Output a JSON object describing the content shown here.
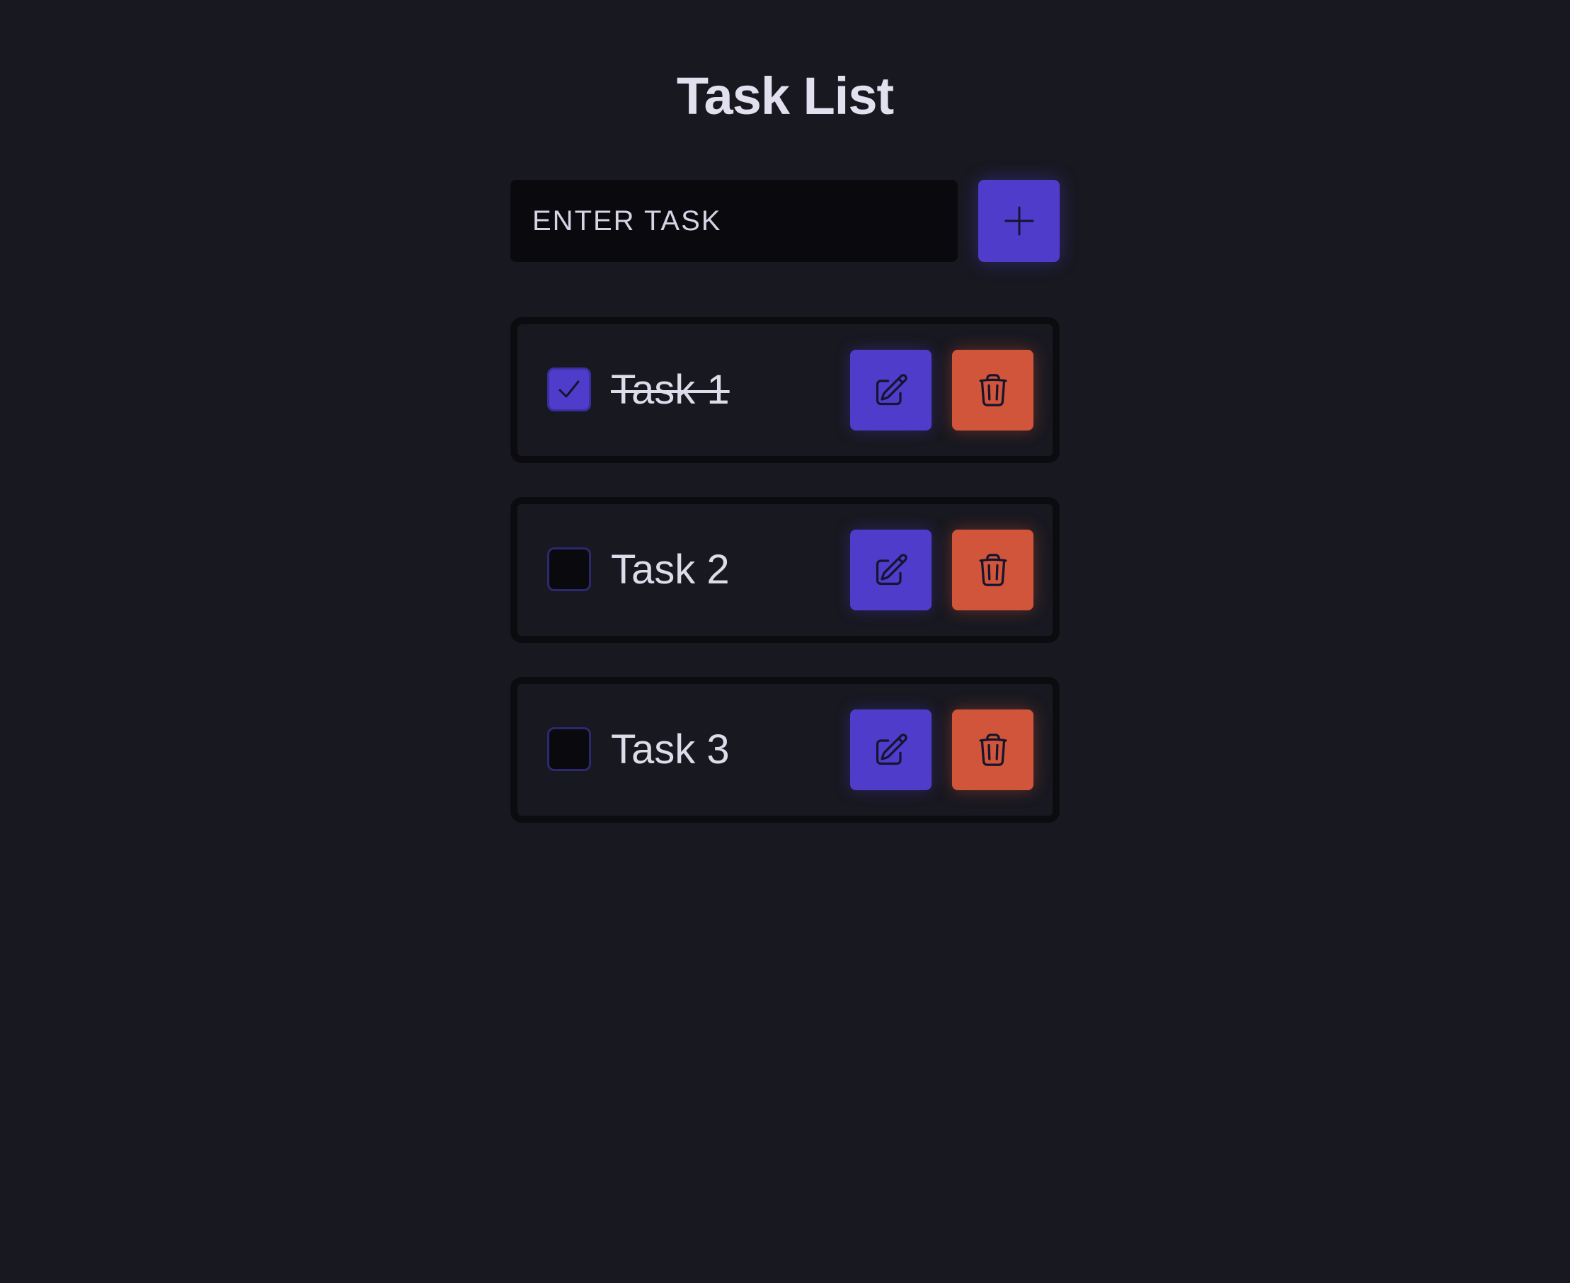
{
  "page": {
    "title": "Task List"
  },
  "add_form": {
    "placeholder": "ENTER TASK",
    "value": "",
    "add_icon": "plus-icon"
  },
  "tasks": [
    {
      "label": "Task 1",
      "completed": true
    },
    {
      "label": "Task 2",
      "completed": false
    },
    {
      "label": "Task 3",
      "completed": false
    }
  ],
  "icons": {
    "edit": "pencil-edit-icon",
    "delete": "trash-icon",
    "check": "check-icon"
  },
  "colors": {
    "background": "#181820",
    "primary": "#4f3ccb",
    "danger": "#d0553a",
    "text": "#dcdcea"
  }
}
